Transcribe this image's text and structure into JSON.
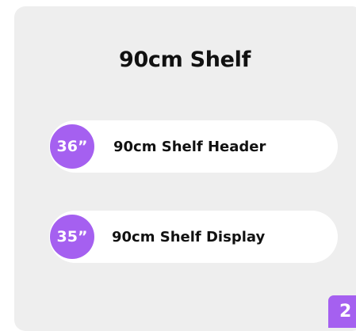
{
  "card": {
    "title": "90cm Shelf"
  },
  "options": [
    {
      "badge": "36”",
      "label": "90cm Shelf Header"
    },
    {
      "badge": "35”",
      "label": "90cm Shelf Display"
    }
  ],
  "page_badge": "2",
  "colors": {
    "accent": "#a560f0",
    "card_background": "#eeeeee",
    "option_background": "#ffffff",
    "text": "#111111"
  }
}
